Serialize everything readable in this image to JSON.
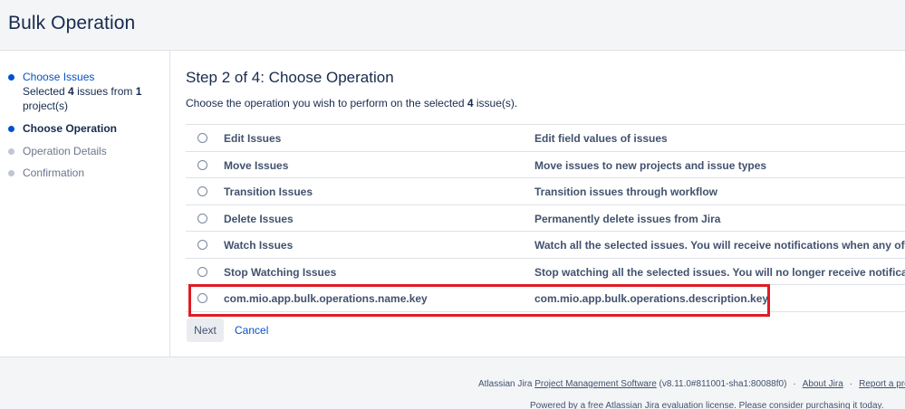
{
  "header": {
    "title": "Bulk Operation"
  },
  "sidebar": {
    "steps": [
      {
        "title": "Choose Issues",
        "sub_prefix": "Selected ",
        "sub_count": "4",
        "sub_mid": " issues from ",
        "sub_projects": "1",
        "sub_suffix": " project(s)"
      },
      {
        "title": "Choose Operation"
      },
      {
        "title": "Operation Details"
      },
      {
        "title": "Confirmation"
      }
    ]
  },
  "main": {
    "heading": "Step 2 of 4: Choose Operation",
    "intro_prefix": "Choose the operation you wish to perform on the selected ",
    "intro_count": "4",
    "intro_suffix": " issue(s).",
    "operations": [
      {
        "name": "Edit Issues",
        "description": "Edit field values of issues"
      },
      {
        "name": "Move Issues",
        "description": "Move issues to new projects and issue types"
      },
      {
        "name": "Transition Issues",
        "description": "Transition issues through workflow"
      },
      {
        "name": "Delete Issues",
        "description": "Permanently delete issues from Jira"
      },
      {
        "name": "Watch Issues",
        "description": "Watch all the selected issues. You will receive notifications when any of these is"
      },
      {
        "name": "Stop Watching Issues",
        "description": "Stop watching all the selected issues. You will no longer receive notifications w"
      },
      {
        "name": "com.mio.app.bulk.operations.name.key",
        "description": "com.mio.app.bulk.operations.description.key"
      }
    ],
    "next_label": "Next",
    "cancel_label": "Cancel"
  },
  "footer": {
    "prefix": "Atlassian Jira ",
    "pms_link": "Project Management Software",
    "version": " (v8.11.0#811001-sha1:80088f0)",
    "separator": "·",
    "about_link": "About Jira",
    "report_link": "Report a prob",
    "license": "Powered by a free Atlassian Jira evaluation license. Please consider purchasing it today."
  },
  "colors": {
    "accent": "#0052cc",
    "highlight": "#e01b24",
    "text": "#172b4d"
  }
}
